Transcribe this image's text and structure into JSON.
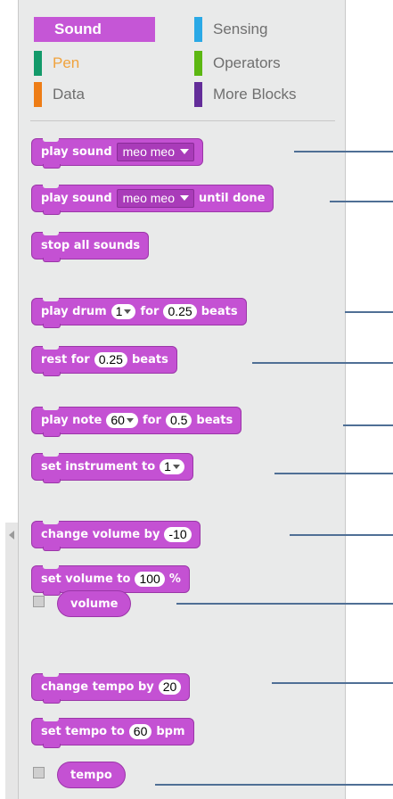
{
  "categories": [
    {
      "label": "Sound",
      "color": "#c556d6",
      "selected": true
    },
    {
      "label": "Sensing",
      "color": "#2aa9e6",
      "selected": false
    },
    {
      "label": "Pen",
      "color": "#139a6a",
      "selected": false
    },
    {
      "label": "Operators",
      "color": "#5cb712",
      "selected": false
    },
    {
      "label": "Data",
      "color": "#ee7d16",
      "selected": false
    },
    {
      "label": "More Blocks",
      "color": "#632d99",
      "selected": false
    }
  ],
  "blocks": {
    "play_sound": {
      "text": "play sound",
      "value": "meo meo"
    },
    "play_sound_until": {
      "text": "play sound",
      "value": "meo meo",
      "suffix": "until done"
    },
    "stop_all": {
      "text": "stop all sounds"
    },
    "play_drum": {
      "text": "play drum",
      "drum": "1",
      "for": "for",
      "beats_value": "0.25",
      "beats": "beats"
    },
    "rest": {
      "text": "rest for",
      "value": "0.25",
      "beats": "beats"
    },
    "play_note": {
      "text": "play note",
      "note": "60",
      "for": "for",
      "beats_value": "0.5",
      "beats": "beats"
    },
    "set_instrument": {
      "text": "set instrument to",
      "value": "1"
    },
    "change_volume": {
      "text": "change volume by",
      "value": "-10"
    },
    "set_volume": {
      "text": "set volume to",
      "value": "100",
      "unit": "%"
    },
    "volume_reporter": {
      "text": "volume",
      "checked": false
    },
    "change_tempo": {
      "text": "change tempo by",
      "value": "20"
    },
    "set_tempo": {
      "text": "set tempo to",
      "value": "60",
      "unit": "bpm"
    },
    "tempo_reporter": {
      "text": "tempo",
      "checked": false
    }
  },
  "colors": {
    "sound_block": "#c451d3",
    "annotation_line": "#4f6f95"
  }
}
